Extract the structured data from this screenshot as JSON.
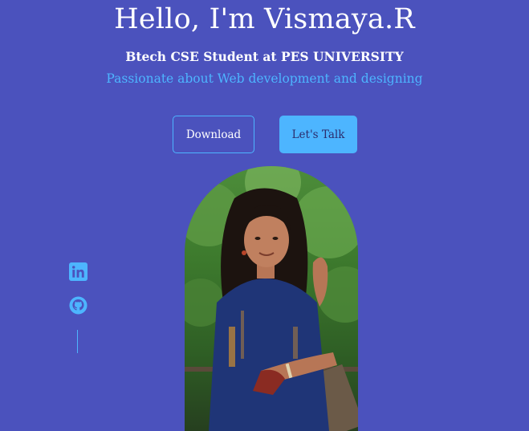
{
  "hero": {
    "title": "Hello, I'm Vismaya.R",
    "subtitle": "Btech CSE Student at PES UNIVERSITY",
    "tagline": "Passionate about Web development and designing"
  },
  "buttons": {
    "download_label": "Download",
    "talk_label": "Let's Talk"
  },
  "socials": {
    "icons": [
      "linkedin-icon",
      "github-icon"
    ]
  },
  "colors": {
    "background": "#4b52bd",
    "accent": "#4db5ff",
    "text": "#ffffff",
    "dark_text": "#2c2c6c"
  }
}
